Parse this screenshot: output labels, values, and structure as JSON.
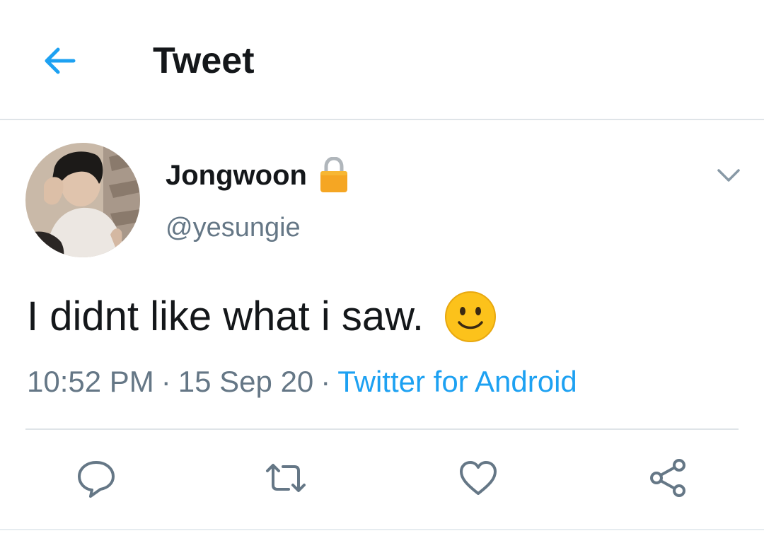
{
  "header": {
    "title": "Tweet",
    "back_icon": "arrow-left-icon"
  },
  "tweet": {
    "author": {
      "display_name": "Jongwoon",
      "handle": "@yesungie",
      "protected_icon": "lock-icon",
      "avatar_icon": "profile-photo"
    },
    "text": "I didnt like what i saw.",
    "emoji_icon": "slightly-smiling-face-icon",
    "time": "10:52 PM",
    "separator": "·",
    "date": "15 Sep 20",
    "source": "Twitter for Android",
    "menu_icon": "chevron-down-icon"
  },
  "actions": [
    {
      "name": "reply",
      "icon": "reply-icon"
    },
    {
      "name": "retweet",
      "icon": "retweet-icon"
    },
    {
      "name": "like",
      "icon": "heart-icon"
    },
    {
      "name": "share",
      "icon": "share-icon"
    }
  ],
  "colors": {
    "accent": "#1da1f2",
    "text_primary": "#14171a",
    "text_secondary": "#657786",
    "divider": "#dfe4e8",
    "lock": "#f5a623"
  }
}
